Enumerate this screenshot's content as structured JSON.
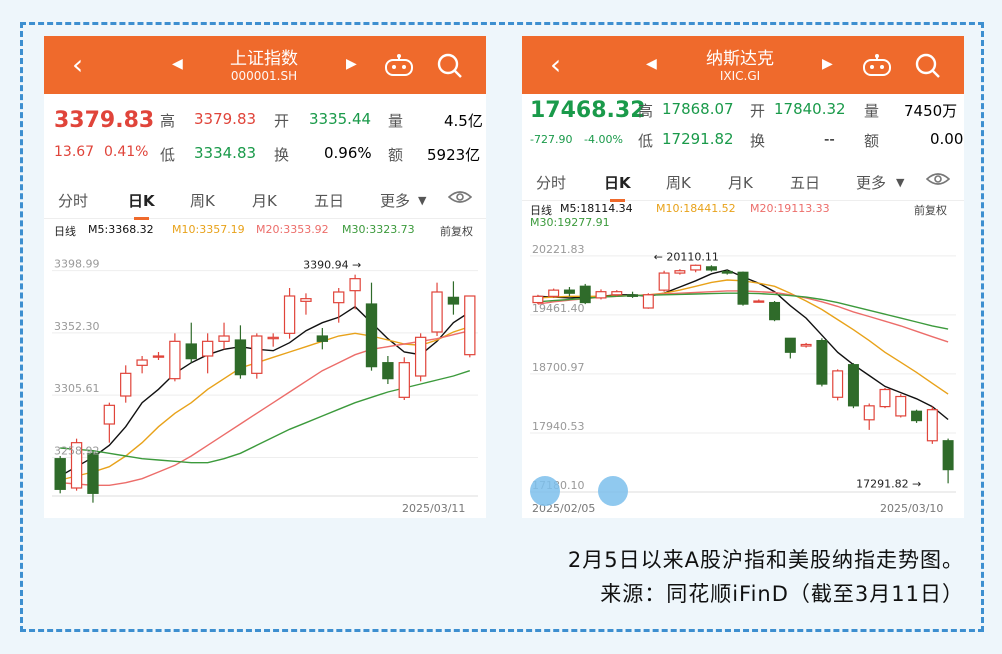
{
  "left": {
    "title": "上证指数",
    "code": "000001.SH",
    "price": "3379.83",
    "change": "13.67",
    "change_pct": "0.41%",
    "quote": {
      "high_label": "高",
      "high": "3379.83",
      "open_label": "开",
      "open": "3335.44",
      "vol_label": "量",
      "vol": "4.5亿",
      "low_label": "低",
      "low": "3334.83",
      "turn_label": "换",
      "turn": "0.96%",
      "amt_label": "额",
      "amt": "5923亿"
    },
    "tabs": [
      "分时",
      "日K",
      "周K",
      "月K",
      "五日",
      "更多"
    ],
    "active_tab": "日K",
    "ma": {
      "kline": "日线",
      "m5": "M5:3368.32",
      "m10": "M10:3357.19",
      "m20": "M20:3353.92",
      "m30": "M30:3323.73"
    },
    "adjust": "前复权",
    "max_label": "3390.94",
    "date_end": "2025/03/11"
  },
  "right": {
    "title": "纳斯达克",
    "code": "IXIC.GI",
    "price": "17468.32",
    "change": "-727.90",
    "change_pct": "-4.00%",
    "quote": {
      "high_label": "高",
      "high": "17868.07",
      "open_label": "开",
      "open": "17840.32",
      "vol_label": "量",
      "vol": "7450万",
      "low_label": "低",
      "low": "17291.82",
      "turn_label": "换",
      "turn": "--",
      "amt_label": "额",
      "amt": "0.00"
    },
    "tabs": [
      "分时",
      "日K",
      "周K",
      "月K",
      "五日",
      "更多"
    ],
    "active_tab": "日K",
    "ma": {
      "kline": "日线",
      "m5": "M5:18114.34",
      "m10": "M10:18441.52",
      "m20": "M20:19113.33",
      "m30": "M30:19277.91"
    },
    "adjust": "前复权",
    "max_label": "20110.11",
    "min_label": "17291.82",
    "date_start": "2025/02/05",
    "date_end": "2025/03/10"
  },
  "caption": {
    "line1": "2月5日以来A股沪指和美股纳指走势图。",
    "line2": "来源：同花顺iFinD（截至3月11日）"
  },
  "colors": {
    "up": "#e0443a",
    "down": "#2f6b2a",
    "m5": "#111111",
    "m10": "#e8a21a",
    "m20": "#ec6d6a",
    "m30": "#3c9a3c",
    "accent": "#ef6a2c"
  },
  "chart_data": [
    {
      "type": "candlestick",
      "title": "上证指数",
      "y_ticks": [
        3398.99,
        3352.3,
        3305.61,
        3258.92
      ],
      "ylim": [
        3230,
        3410
      ],
      "candles": [
        {
          "o": 3258,
          "c": 3235,
          "h": 3260,
          "l": 3232
        },
        {
          "o": 3236,
          "c": 3270,
          "h": 3273,
          "l": 3234
        },
        {
          "o": 3262,
          "c": 3232,
          "h": 3264,
          "l": 3225
        },
        {
          "o": 3284,
          "c": 3298,
          "h": 3300,
          "l": 3270
        },
        {
          "o": 3305,
          "c": 3322,
          "h": 3328,
          "l": 3300
        },
        {
          "o": 3328,
          "c": 3332,
          "h": 3335,
          "l": 3322
        },
        {
          "o": 3335,
          "c": 3335,
          "h": 3338,
          "l": 3332
        },
        {
          "o": 3318,
          "c": 3346,
          "h": 3352,
          "l": 3316
        },
        {
          "o": 3344,
          "c": 3333,
          "h": 3360,
          "l": 3330
        },
        {
          "o": 3335,
          "c": 3346,
          "h": 3352,
          "l": 3322
        },
        {
          "o": 3346,
          "c": 3350,
          "h": 3360,
          "l": 3340
        },
        {
          "o": 3347,
          "c": 3321,
          "h": 3358,
          "l": 3318
        },
        {
          "o": 3322,
          "c": 3350,
          "h": 3352,
          "l": 3318
        },
        {
          "o": 3348,
          "c": 3349,
          "h": 3352,
          "l": 3342
        },
        {
          "o": 3352,
          "c": 3380,
          "h": 3386,
          "l": 3348
        },
        {
          "o": 3376,
          "c": 3378,
          "h": 3382,
          "l": 3366
        },
        {
          "o": 3350,
          "c": 3346,
          "h": 3356,
          "l": 3340
        },
        {
          "o": 3375,
          "c": 3383,
          "h": 3386,
          "l": 3360
        },
        {
          "o": 3384,
          "c": 3393,
          "h": 3396,
          "l": 3370
        },
        {
          "o": 3374,
          "c": 3327,
          "h": 3390,
          "l": 3324
        },
        {
          "o": 3330,
          "c": 3318,
          "h": 3335,
          "l": 3314
        },
        {
          "o": 3304,
          "c": 3330,
          "h": 3334,
          "l": 3302
        },
        {
          "o": 3320,
          "c": 3349,
          "h": 3352,
          "l": 3316
        },
        {
          "o": 3353,
          "c": 3383,
          "h": 3390,
          "l": 3350
        },
        {
          "o": 3379,
          "c": 3374,
          "h": 3391,
          "l": 3366
        },
        {
          "o": 3336,
          "c": 3380,
          "h": 3380,
          "l": 3334
        }
      ],
      "series": [
        {
          "name": "M5",
          "values": [
            3245,
            3252,
            3259,
            3268,
            3282,
            3300,
            3310,
            3322,
            3330,
            3336,
            3340,
            3342,
            3340,
            3339,
            3345,
            3354,
            3360,
            3364,
            3372,
            3360,
            3348,
            3338,
            3336,
            3346,
            3360,
            3368
          ]
        },
        {
          "name": "M10",
          "values": [
            3242,
            3245,
            3248,
            3252,
            3260,
            3270,
            3282,
            3292,
            3300,
            3310,
            3318,
            3326,
            3330,
            3334,
            3338,
            3342,
            3346,
            3350,
            3352,
            3350,
            3347,
            3344,
            3343,
            3347,
            3353,
            3357
          ]
        },
        {
          "name": "M20",
          "values": [
            3240,
            3239,
            3238,
            3238,
            3240,
            3243,
            3248,
            3253,
            3260,
            3268,
            3276,
            3284,
            3292,
            3300,
            3308,
            3316,
            3324,
            3330,
            3336,
            3340,
            3342,
            3344,
            3346,
            3348,
            3351,
            3354
          ]
        },
        {
          "name": "M30",
          "values": [
            3266,
            3265,
            3264,
            3262,
            3260,
            3258,
            3257,
            3256,
            3255,
            3255,
            3258,
            3262,
            3268,
            3274,
            3280,
            3285,
            3290,
            3295,
            3300,
            3304,
            3308,
            3311,
            3314,
            3317,
            3320,
            3324
          ]
        }
      ]
    },
    {
      "type": "candlestick",
      "title": "纳斯达克",
      "y_ticks": [
        20221.83,
        19461.4,
        18700.97,
        17940.53,
        17180.1
      ],
      "ylim": [
        17180.1,
        20400
      ],
      "candles": [
        {
          "o": 19620,
          "c": 19700,
          "h": 19720,
          "l": 19600
        },
        {
          "o": 19700,
          "c": 19780,
          "h": 19800,
          "l": 19680
        },
        {
          "o": 19780,
          "c": 19740,
          "h": 19820,
          "l": 19700
        },
        {
          "o": 19830,
          "c": 19620,
          "h": 19860,
          "l": 19600
        },
        {
          "o": 19680,
          "c": 19760,
          "h": 19790,
          "l": 19660
        },
        {
          "o": 19720,
          "c": 19760,
          "h": 19780,
          "l": 19700
        },
        {
          "o": 19720,
          "c": 19700,
          "h": 19760,
          "l": 19680
        },
        {
          "o": 19550,
          "c": 19720,
          "h": 19740,
          "l": 19540
        },
        {
          "o": 19780,
          "c": 20000,
          "h": 20030,
          "l": 19760
        },
        {
          "o": 20000,
          "c": 20030,
          "h": 20050,
          "l": 19980
        },
        {
          "o": 20040,
          "c": 20100,
          "h": 20110.11,
          "l": 20010
        },
        {
          "o": 20080,
          "c": 20040,
          "h": 20100,
          "l": 20020
        },
        {
          "o": 20020,
          "c": 20000,
          "h": 20040,
          "l": 19980
        },
        {
          "o": 20010,
          "c": 19600,
          "h": 20020,
          "l": 19580
        },
        {
          "o": 19640,
          "c": 19640,
          "h": 19660,
          "l": 19620
        },
        {
          "o": 19620,
          "c": 19400,
          "h": 19640,
          "l": 19380
        },
        {
          "o": 19160,
          "c": 18980,
          "h": 19160,
          "l": 18900
        },
        {
          "o": 19060,
          "c": 19080,
          "h": 19100,
          "l": 19040
        },
        {
          "o": 19130,
          "c": 18570,
          "h": 19160,
          "l": 18540
        },
        {
          "o": 18400,
          "c": 18740,
          "h": 18760,
          "l": 18360
        },
        {
          "o": 18820,
          "c": 18290,
          "h": 18840,
          "l": 18260
        },
        {
          "o": 18110,
          "c": 18290,
          "h": 18320,
          "l": 17980
        },
        {
          "o": 18280,
          "c": 18500,
          "h": 18520,
          "l": 18260
        },
        {
          "o": 18160,
          "c": 18410,
          "h": 18440,
          "l": 18140
        },
        {
          "o": 18220,
          "c": 18100,
          "h": 18240,
          "l": 18070
        },
        {
          "o": 17840,
          "c": 18240,
          "h": 18280,
          "l": 17800
        },
        {
          "o": 17840.32,
          "c": 17468.32,
          "h": 17868.07,
          "l": 17291.82
        }
      ],
      "series": [
        {
          "name": "M5",
          "values": [
            19700,
            19690,
            19680,
            19690,
            19700,
            19720,
            19720,
            19700,
            19740,
            19820,
            19900,
            19990,
            20040,
            19950,
            19870,
            19760,
            19580,
            19420,
            19200,
            18980,
            18820,
            18680,
            18540,
            18460,
            18380,
            18280,
            18114
          ]
        },
        {
          "name": "M10",
          "values": [
            19680,
            19690,
            19700,
            19700,
            19700,
            19705,
            19710,
            19720,
            19740,
            19780,
            19830,
            19880,
            19910,
            19900,
            19870,
            19830,
            19740,
            19640,
            19530,
            19400,
            19270,
            19130,
            18980,
            18850,
            18720,
            18580,
            18441
          ]
        },
        {
          "name": "M20",
          "values": [
            19600,
            19630,
            19650,
            19670,
            19690,
            19700,
            19710,
            19720,
            19730,
            19740,
            19750,
            19760,
            19770,
            19770,
            19760,
            19750,
            19720,
            19680,
            19630,
            19570,
            19500,
            19440,
            19380,
            19320,
            19250,
            19180,
            19113
          ]
        },
        {
          "name": "M30",
          "values": [
            19630,
            19645,
            19660,
            19675,
            19690,
            19700,
            19710,
            19715,
            19720,
            19725,
            19730,
            19735,
            19740,
            19740,
            19735,
            19725,
            19710,
            19690,
            19660,
            19620,
            19570,
            19520,
            19470,
            19420,
            19370,
            19320,
            19278
          ]
        }
      ]
    }
  ]
}
